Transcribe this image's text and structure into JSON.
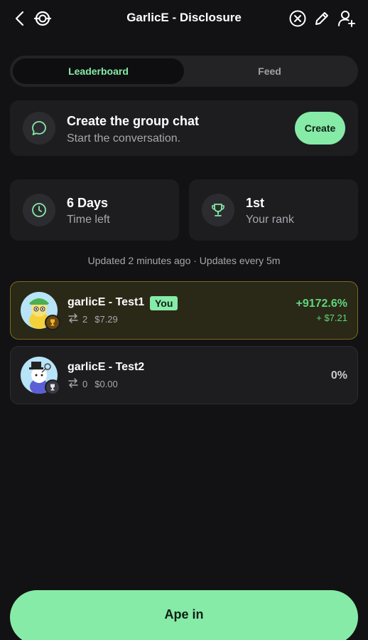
{
  "header": {
    "title": "GarlicE - Disclosure",
    "icons": [
      "back-icon",
      "group-logo-icon",
      "close-circle-icon",
      "edit-icon",
      "add-user-icon"
    ]
  },
  "tabs": [
    {
      "label": "Leaderboard",
      "active": true
    },
    {
      "label": "Feed",
      "active": false
    }
  ],
  "group_chat": {
    "title": "Create the group chat",
    "subtitle": "Start the conversation.",
    "button_label": "Create",
    "icon": "chat-bubble-icon"
  },
  "stats": {
    "time": {
      "value": "6 Days",
      "label": "Time left",
      "icon": "clock-icon"
    },
    "rank": {
      "value": "1st",
      "label": "Your rank",
      "icon": "trophy-icon"
    }
  },
  "updated_text": "Updated 2 minutes ago · Updates every 5m",
  "leaderboard": [
    {
      "name": "garlicE - Test1",
      "badge": "You",
      "trades": "2",
      "value": "$7.29",
      "percent": "+9172.6%",
      "gain": "+ $7.21",
      "rank_medal": "gold"
    },
    {
      "name": "garlicE - Test2",
      "badge": "",
      "trades": "0",
      "value": "$0.00",
      "percent": "0%",
      "gain": "",
      "rank_medal": "silver"
    }
  ],
  "cta": {
    "label": "Ape in"
  },
  "colors": {
    "accent": "#86eba7",
    "background": "#121214",
    "card": "#1d1d20",
    "highlight_border": "#7a6a1f",
    "positive": "#5fd67d"
  }
}
